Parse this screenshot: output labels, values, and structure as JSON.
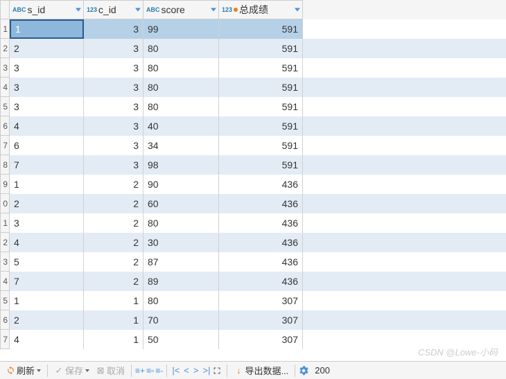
{
  "columns": [
    {
      "key": "s_id",
      "label": "s_id",
      "type": "ABC",
      "align": "left"
    },
    {
      "key": "c_id",
      "label": "c_id",
      "type": "123",
      "align": "right"
    },
    {
      "key": "score",
      "label": "score",
      "type": "ABC",
      "align": "left"
    },
    {
      "key": "total",
      "label": "总成绩",
      "type": "123",
      "align": "right",
      "hasDot": true
    }
  ],
  "rows": [
    {
      "n": "1",
      "s_id": "1",
      "c_id": "3",
      "score": "99",
      "total": "591",
      "selected": true
    },
    {
      "n": "2",
      "s_id": "2",
      "c_id": "3",
      "score": "80",
      "total": "591"
    },
    {
      "n": "3",
      "s_id": "3",
      "c_id": "3",
      "score": "80",
      "total": "591"
    },
    {
      "n": "4",
      "s_id": "3",
      "c_id": "3",
      "score": "80",
      "total": "591"
    },
    {
      "n": "5",
      "s_id": "3",
      "c_id": "3",
      "score": "80",
      "total": "591"
    },
    {
      "n": "6",
      "s_id": "4",
      "c_id": "3",
      "score": "40",
      "total": "591"
    },
    {
      "n": "7",
      "s_id": "6",
      "c_id": "3",
      "score": "34",
      "total": "591"
    },
    {
      "n": "8",
      "s_id": "7",
      "c_id": "3",
      "score": "98",
      "total": "591"
    },
    {
      "n": "9",
      "s_id": "1",
      "c_id": "2",
      "score": "90",
      "total": "436"
    },
    {
      "n": "0",
      "s_id": "2",
      "c_id": "2",
      "score": "60",
      "total": "436"
    },
    {
      "n": "1",
      "s_id": "3",
      "c_id": "2",
      "score": "80",
      "total": "436"
    },
    {
      "n": "2",
      "s_id": "4",
      "c_id": "2",
      "score": "30",
      "total": "436"
    },
    {
      "n": "3",
      "s_id": "5",
      "c_id": "2",
      "score": "87",
      "total": "436"
    },
    {
      "n": "4",
      "s_id": "7",
      "c_id": "2",
      "score": "89",
      "total": "436"
    },
    {
      "n": "5",
      "s_id": "1",
      "c_id": "1",
      "score": "80",
      "total": "307"
    },
    {
      "n": "6",
      "s_id": "2",
      "c_id": "1",
      "score": "70",
      "total": "307"
    },
    {
      "n": "7",
      "s_id": "4",
      "c_id": "1",
      "score": "50",
      "total": "307"
    }
  ],
  "toolbar": {
    "refresh": "刷新",
    "save": "保存",
    "cancel": "取消",
    "export": "导出数据...",
    "count": "200"
  },
  "watermark": "CSDN @Lowe-小码"
}
